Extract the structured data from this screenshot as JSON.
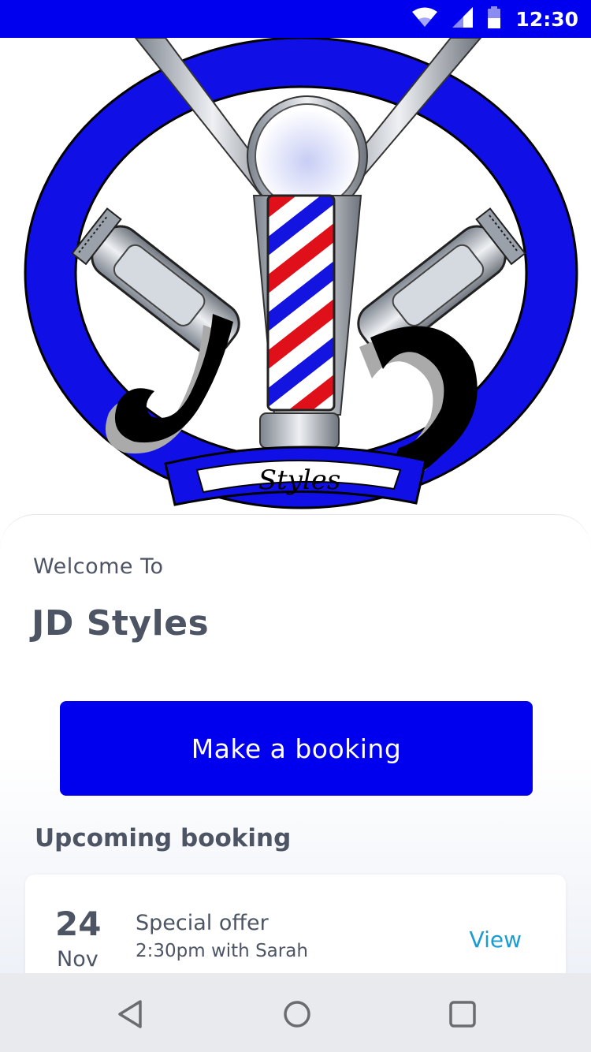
{
  "status_bar": {
    "time": "12:30",
    "icons": [
      "wifi-icon",
      "signal-icon",
      "battery-icon"
    ],
    "background": "#0000ee"
  },
  "logo": {
    "description_icon": "jd-styles-logo",
    "wordmark": "JD Styles"
  },
  "welcome": {
    "label": "Welcome To",
    "shop_name": "JD Styles"
  },
  "actions": {
    "make_booking_label": "Make a booking",
    "button_color": "#0000ee"
  },
  "upcoming": {
    "heading": "Upcoming booking",
    "booking": {
      "day": "24",
      "month": "Nov",
      "title": "Special offer",
      "detail": "2:30pm with Sarah",
      "view_label": "View",
      "link_color": "#1a9cd1"
    }
  },
  "nav_bar": {
    "buttons": [
      "back-icon",
      "home-icon",
      "recents-icon"
    ]
  }
}
